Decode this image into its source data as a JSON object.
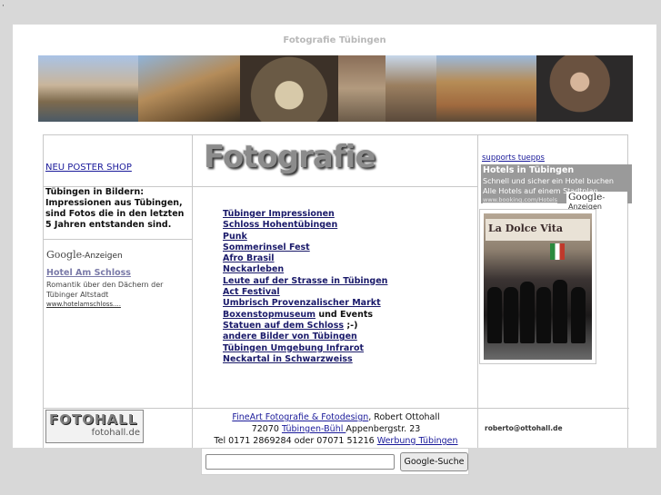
{
  "page": {
    "corner_mark": "·",
    "site_title": "Fotografie  Tübingen"
  },
  "banner": {
    "alt_segments": [
      "riverfront",
      "punts",
      "archway",
      "old-town",
      "alley",
      "town-hall",
      "violinist"
    ]
  },
  "left": {
    "shop_link": "NEU POSTER SHOP",
    "intro": "Tübingen in Bildern: Impressionen aus Tübingen, sind Fotos die in den letzten 5 Jahren entstanden sind.",
    "ads_label_google": "Google",
    "ads_label_suffix": "-Anzeigen",
    "ad_title": "Hotel Am Schloss",
    "ad_text": "Romantik über den Dächern der Tübinger Altstadt",
    "ad_url": "www.hotelamschloss...."
  },
  "center": {
    "logo_text": "Fotografie",
    "links": [
      {
        "text": "Tübinger Impressionen",
        "suffix": ""
      },
      {
        "text": "Schloss Hohentübingen",
        "suffix": ""
      },
      {
        "text": "Punk",
        "suffix": ""
      },
      {
        "text": "Sommerinsel Fest",
        "suffix": ""
      },
      {
        "text": "Afro Brasil",
        "suffix": ""
      },
      {
        "text": "Neckarleben",
        "suffix": ""
      },
      {
        "text": "Leute auf der Strasse in Tübingen",
        "suffix": ""
      },
      {
        "text": "Act Festival",
        "suffix": ""
      },
      {
        "text": "Umbrisch Provenzalischer Markt",
        "suffix": ""
      },
      {
        "text": "Boxenstopmuseum",
        "suffix": " und Events"
      },
      {
        "text": "Statuen auf dem Schloss",
        "suffix": " ;-)"
      },
      {
        "text": "andere Bilder von Tübingen",
        "suffix": ""
      },
      {
        "text": "Tübingen Umgebung Infrarot",
        "suffix": ""
      },
      {
        "text": "Neckartal in Schwarzweiss",
        "suffix": ""
      }
    ]
  },
  "right": {
    "supports": "supports  tuepps",
    "hotel_title": "Hotels in Tübingen",
    "hotel_line1": "Schnell und sicher ein Hotel buchen",
    "hotel_line2": "Alle Hotels auf einem Stadtplan",
    "hotel_url": "www.booking.com/Hotels",
    "badge_google": "Google",
    "badge_suffix": "-Anzeigen",
    "photo_sign": "La Dolce Vita"
  },
  "footer": {
    "logo_big": "FOTOHALL",
    "logo_small": "fotohall.de",
    "line1_link": "FineArt Fotografie & Fotodesign",
    "line1_rest": ", Robert Ottohall",
    "line2_pre": "72070 ",
    "line2_link": "Tübingen-Bühl ",
    "line2_rest": "Appenbergstr. 23",
    "line3_pre": "Tel 0171 2869284 oder 07071 51216 ",
    "line3_link": "Werbung Tübingen",
    "email": "roberto@ottohall.de"
  },
  "search": {
    "button_label": "Google-Suche",
    "value": ""
  }
}
